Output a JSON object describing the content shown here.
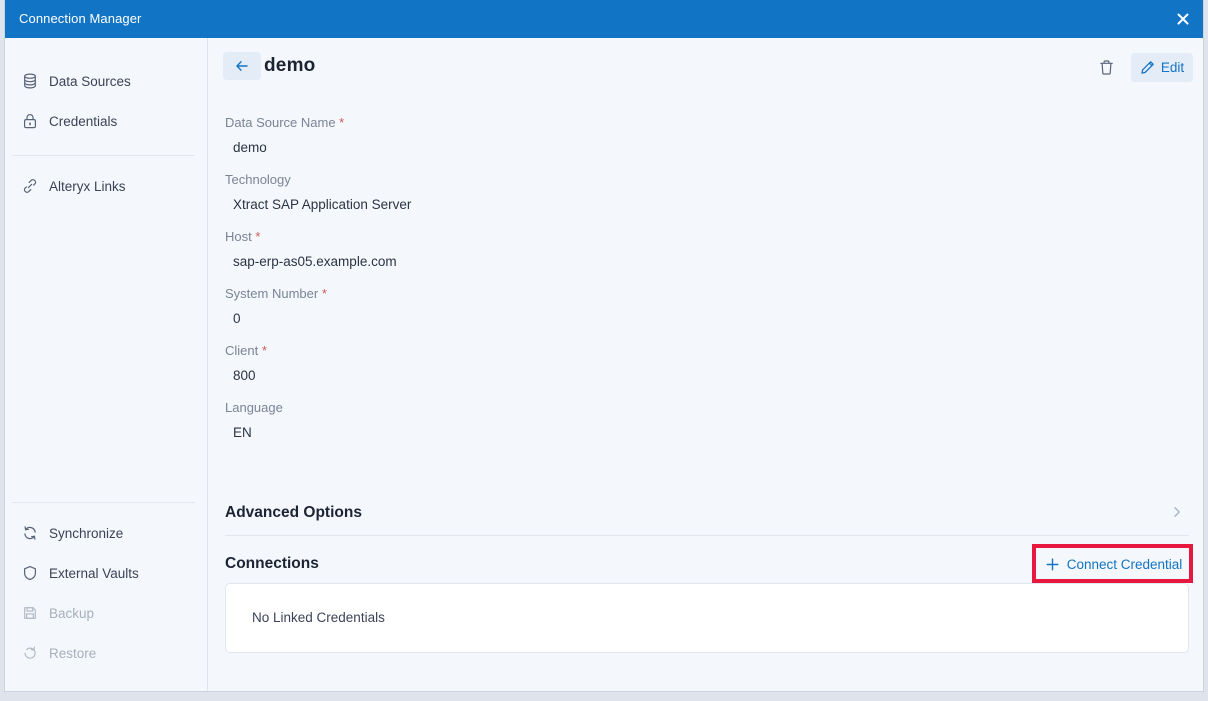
{
  "window": {
    "title": "Connection Manager",
    "close_icon": "close-icon",
    "accent_blue": "#1274c4",
    "background": "#f4f7fb",
    "highlight_red": "#e8173d"
  },
  "sidebar": {
    "groups": [
      {
        "items": [
          {
            "label": "Data Sources",
            "icon": "database-icon",
            "disabled": false
          },
          {
            "label": "Credentials",
            "icon": "lock-icon",
            "disabled": false
          }
        ]
      },
      {
        "items": [
          {
            "label": "Alteryx Links",
            "icon": "link-icon",
            "disabled": false
          }
        ]
      },
      {
        "items": [
          {
            "label": "Synchronize",
            "icon": "sync-icon",
            "disabled": false
          },
          {
            "label": "External Vaults",
            "icon": "shield-icon",
            "disabled": false
          },
          {
            "label": "Backup",
            "icon": "save-icon",
            "disabled": true
          },
          {
            "label": "Restore",
            "icon": "restore-icon",
            "disabled": true
          }
        ]
      }
    ]
  },
  "header": {
    "back_icon": "arrow-left-icon",
    "title": "demo",
    "delete_icon": "trash-icon",
    "edit_icon": "pencil-icon",
    "edit_label": "Edit"
  },
  "fields": [
    {
      "label": "Data Source Name",
      "required": true,
      "value": "demo"
    },
    {
      "label": "Technology",
      "required": false,
      "value": "Xtract SAP Application Server"
    },
    {
      "label": "Host",
      "required": true,
      "value": "sap-erp-as05.example.com"
    },
    {
      "label": "System Number",
      "required": true,
      "value": "0"
    },
    {
      "label": "Client",
      "required": true,
      "value": "800"
    },
    {
      "label": "Language",
      "required": false,
      "value": "EN"
    }
  ],
  "advanced_options": {
    "title": "Advanced Options",
    "chevron_icon": "chevron-right-icon",
    "expanded": false
  },
  "connections": {
    "title": "Connections",
    "connect_label": "Connect Credential",
    "connect_icon": "plus-icon",
    "empty_text": "No Linked Credentials",
    "highlighted": true
  }
}
